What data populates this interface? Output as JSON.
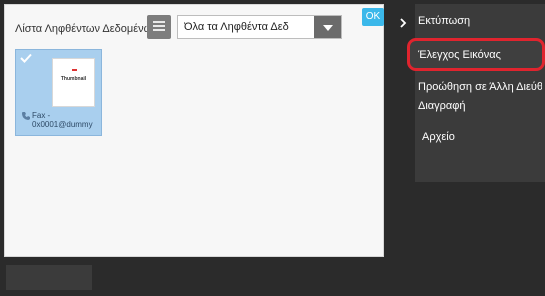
{
  "header": {
    "list_title": "Λίστα Ληφθέντων Δεδομένων",
    "filter_value": "Όλα τα Ληφθέντα Δεδ",
    "ok_label": "OK"
  },
  "thumbnail": {
    "doc_text": "Thumbnail",
    "fax_line1": "Fax -",
    "fax_line2": "0x0001@dummy"
  },
  "menu": {
    "items": [
      "Εκτύπωση",
      "Έλεγχος Εικόνας",
      "Προώθηση σε Άλλη Διεύθ",
      "Διαγραφή",
      "Αρχείο"
    ]
  },
  "colors": {
    "accent": "#3bb8ea",
    "highlight": "#e0242e",
    "selection": "#a9cfee"
  }
}
